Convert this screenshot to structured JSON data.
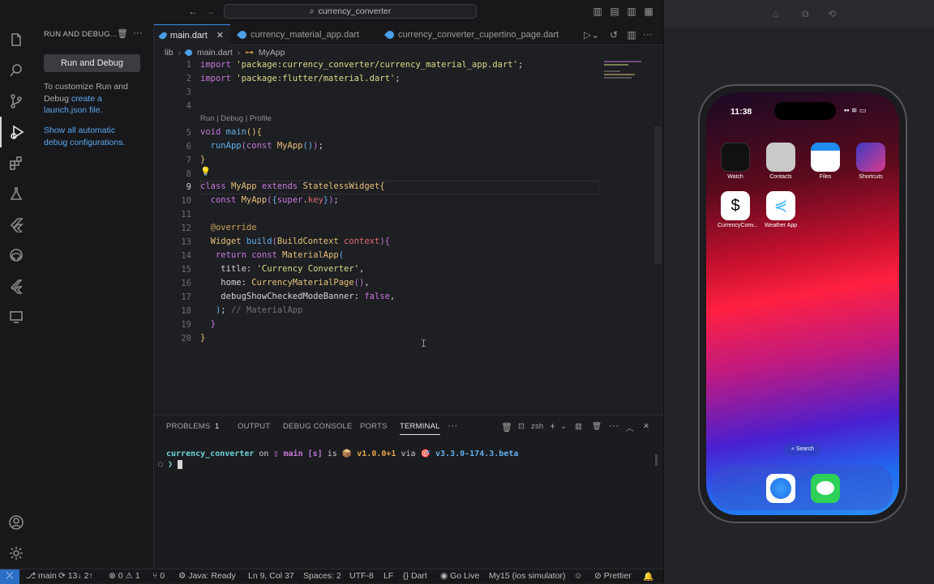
{
  "titlebar": {
    "search": "currency_converter"
  },
  "sidebar": {
    "title": "RUN AND DEBUG...",
    "run_button": "Run and Debug",
    "customize_1": "To customize Run and",
    "customize_2a": "Debug ",
    "customize_link_1": "create a",
    "customize_link_2": "launch.json file",
    "customize_end": ".",
    "show_all_1": "Show all automatic",
    "show_all_2": "debug configurations."
  },
  "tabs": [
    {
      "label": "main.dart"
    },
    {
      "label": "currency_material_app.dart"
    },
    {
      "label": "currency_converter_cupertino_page.dart"
    }
  ],
  "breadcrumb": [
    "lib",
    "main.dart",
    "MyApp"
  ],
  "editor": {
    "codelens": "Run | Debug | Profile",
    "inline_hint": "// MaterialApp",
    "line_numbers": [
      "1",
      "2",
      "3",
      "4",
      "5",
      "6",
      "7",
      "8",
      "9",
      "10",
      "11",
      "12",
      "13",
      "14",
      "15",
      "16",
      "17",
      "18",
      "19",
      "20"
    ]
  },
  "panel": {
    "tabs": [
      "PROBLEMS",
      "OUTPUT",
      "DEBUG CONSOLE",
      "PORTS",
      "TERMINAL"
    ],
    "problems_count": "1",
    "shell": "zsh",
    "prompt": {
      "dir": "currency_converter",
      "on": " on ",
      "branch": " main [s]",
      "is": " is ",
      "version": " v1.0.0+1",
      "via": " via ",
      "dart_version": " v3.3.0-174.3.beta"
    }
  },
  "status": {
    "branch": "main",
    "sync": "13↓ 2↑",
    "errors": "0",
    "warnings": "1",
    "ports": "0",
    "java": "Java: Ready",
    "position": "Ln 9, Col 37",
    "spaces": "Spaces: 2",
    "encoding": "UTF-8",
    "eol": "LF",
    "language": "Dart",
    "golive": "Go Live",
    "device": "My15 (ios simulator)",
    "prettier": "Prettier"
  },
  "phone": {
    "time": "11:38",
    "apps": [
      "Watch",
      "Contacts",
      "Files",
      "Shortcuts",
      "CurrencyConv...",
      "Weather App"
    ],
    "search": "Search"
  },
  "colors": {
    "accent": "#3b8eea",
    "editor_bg": "#1e1f22",
    "sidebar_bg": "#18181b"
  }
}
